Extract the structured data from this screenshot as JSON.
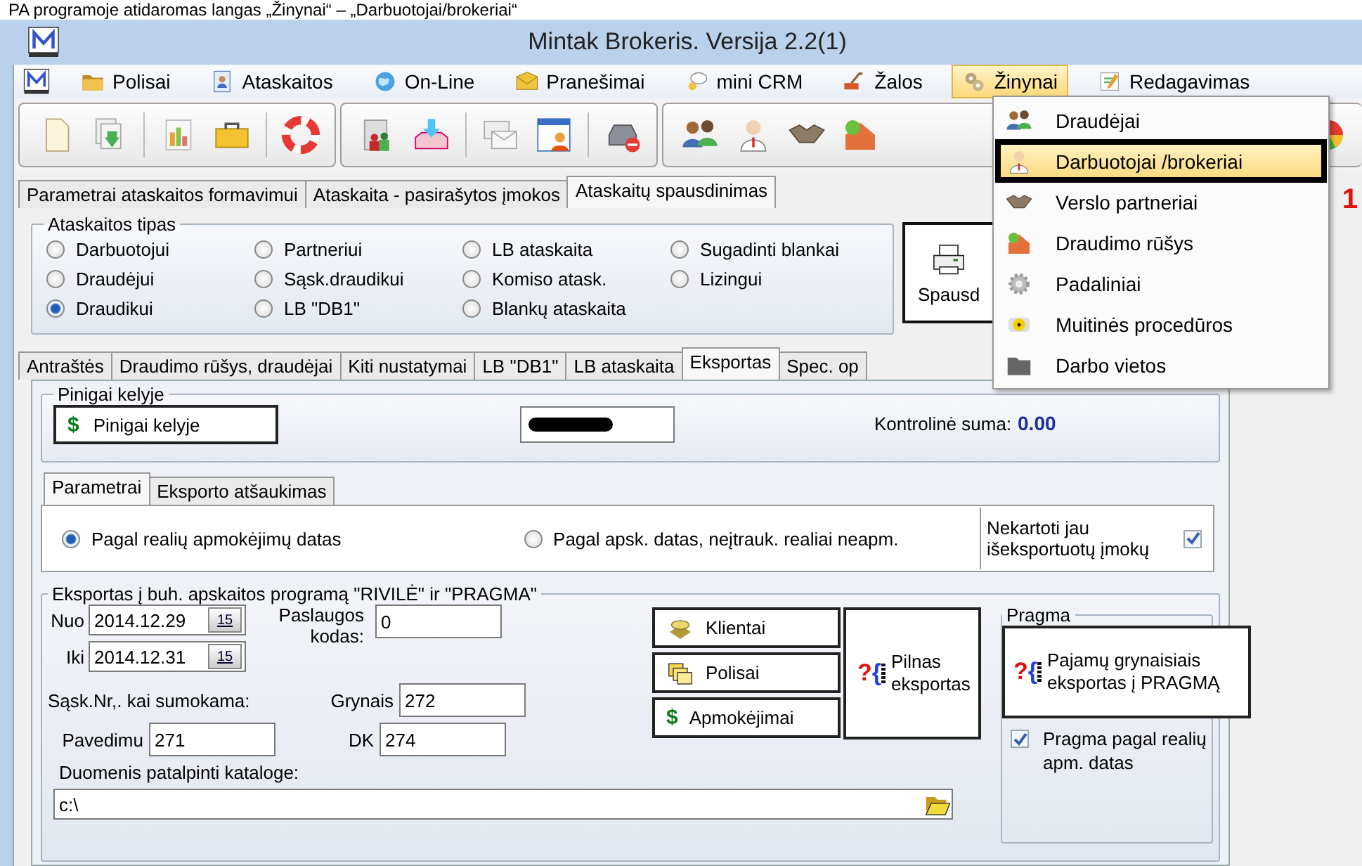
{
  "caption": "PA programoje atidaromas langas „Žinynai“ – „Darbuotojai/brokeriai“",
  "window": {
    "title": "Mintak Brokeris. Versija 2.2(1)"
  },
  "menu": [
    {
      "label": "Polisai",
      "selected": false
    },
    {
      "label": "Ataskaitos",
      "selected": false
    },
    {
      "label": "On-Line",
      "selected": false
    },
    {
      "label": "Pranešimai",
      "selected": false
    },
    {
      "label": "mini CRM",
      "selected": false
    },
    {
      "label": "Žalos",
      "selected": false
    },
    {
      "label": "Žinynai",
      "selected": true
    },
    {
      "label": "Redagavimas",
      "selected": false
    }
  ],
  "dropdown": [
    {
      "label": "Draudėjai",
      "selected": false
    },
    {
      "label": "Darbuotojai /brokeriai",
      "selected": true
    },
    {
      "label": "Verslo partneriai",
      "selected": false
    },
    {
      "label": "Draudimo rūšys",
      "selected": false
    },
    {
      "label": "Padaliniai",
      "selected": false
    },
    {
      "label": "Muitinės procedūros",
      "selected": false
    },
    {
      "label": "Darbo vietos",
      "selected": false
    }
  ],
  "side_mark": "1",
  "report_tabs": [
    {
      "label": "Parametrai ataskaitos formavimui",
      "selected": false
    },
    {
      "label": "Ataskaita - pasirašytos įmokos",
      "selected": false
    },
    {
      "label": "Ataskaitų spausdinimas",
      "selected": true
    }
  ],
  "report_type": {
    "title": "Ataskaitos tipas",
    "options": [
      {
        "label": "Darbuotojui",
        "selected": false
      },
      {
        "label": "Draudėjui",
        "selected": false
      },
      {
        "label": "Draudikui",
        "selected": true
      },
      {
        "label": "Partneriui",
        "selected": false
      },
      {
        "label": "Sąsk.draudikui",
        "selected": false
      },
      {
        "label": "LB \"DB1\"",
        "selected": false
      },
      {
        "label": "LB ataskaita",
        "selected": false
      },
      {
        "label": "Komiso atask.",
        "selected": false
      },
      {
        "label": "Blankų ataskaita",
        "selected": false
      },
      {
        "label": "Sugadinti blankai",
        "selected": false
      },
      {
        "label": "Lizingui",
        "selected": false
      }
    ]
  },
  "print_button": "Spausd",
  "settings_tabs": [
    {
      "label": "Antraštės",
      "selected": false
    },
    {
      "label": "Draudimo rūšys, draudėjai",
      "selected": false
    },
    {
      "label": "Kiti nustatymai",
      "selected": false
    },
    {
      "label": "LB \"DB1\"",
      "selected": false
    },
    {
      "label": "LB ataskaita",
      "selected": false
    },
    {
      "label": "Eksportas",
      "selected": true
    },
    {
      "label": "Spec. op",
      "selected": false
    }
  ],
  "money_in_transit": {
    "title": "Pinigai kelyje",
    "button": {
      "symbol": "$",
      "label": "Pinigai kelyje"
    },
    "checksum_label": "Kontrolinė suma:",
    "checksum": "0.00"
  },
  "export_tabs": [
    {
      "label": "Parametrai",
      "selected": true
    },
    {
      "label": "Eksporto atšaukimas",
      "selected": false
    }
  ],
  "date_mode": [
    {
      "label": "Pagal realių apmokėjimų datas",
      "selected": true
    },
    {
      "label": "Pagal apsk. datas, neįtrauk. realiai neapm.",
      "selected": false
    }
  ],
  "skip_exported": {
    "label": "Nekartoti jau išeksportuotų įmokų",
    "checked": true
  },
  "export": {
    "title": "Eksportas į buh. apskaitos programą \"RIVILĖ\"  ir \"PRAGMA\"",
    "from": {
      "label": "Nuo",
      "value": "2014.12.29",
      "calendar": "15"
    },
    "to": {
      "label": "Iki",
      "value": "2014.12.31",
      "calendar": "15"
    },
    "service_code": {
      "label": "Paslaugos kodas:",
      "value": "0"
    },
    "invoice_label": "Sąsk.Nr,. kai sumokama:",
    "cash": {
      "label": "Grynais",
      "value": "272"
    },
    "transfer": {
      "label": "Pavedimu",
      "value": "271"
    },
    "dk": {
      "label": "DK",
      "value": "274"
    },
    "folder": {
      "label": "Duomenis patalpinti kataloge:",
      "value": "c:\\"
    },
    "buttons": [
      {
        "label": "Klientai"
      },
      {
        "label": "Polisai"
      },
      {
        "symbol": "$",
        "label": "Apmokėjimai"
      }
    ],
    "full_export": {
      "symbol": [
        "?",
        "{"
      ],
      "label": "Pilnas eksportas"
    }
  },
  "pragma": {
    "title": "Pragma",
    "button": {
      "symbol": [
        "?",
        "{"
      ],
      "label": "Pajamų grynaisiais eksportas į PRAGMĄ"
    },
    "real_dates": {
      "label": "Pragma pagal realių apm. datas",
      "checked": true
    }
  }
}
